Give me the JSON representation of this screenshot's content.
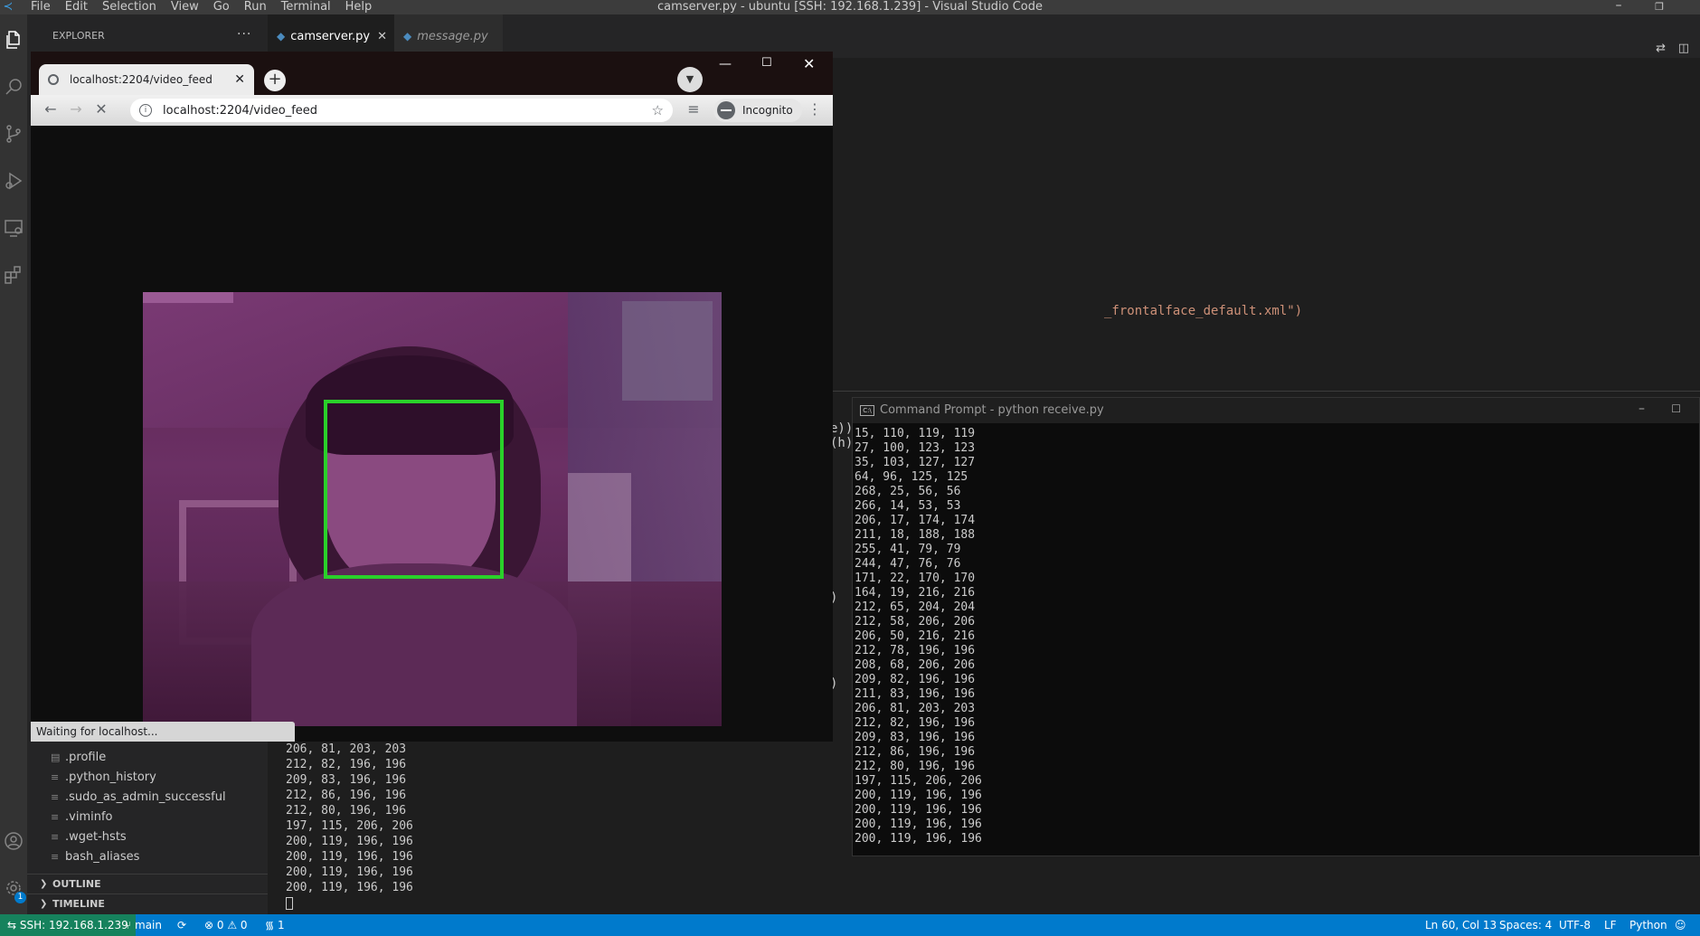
{
  "window": {
    "title": "camserver.py - ubuntu [SSH: 192.168.1.239] - Visual Studio Code",
    "menu": [
      "File",
      "Edit",
      "Selection",
      "View",
      "Go",
      "Run",
      "Terminal",
      "Help"
    ]
  },
  "sidebar": {
    "title": "EXPLORER",
    "more": "···",
    "files": [
      ".profile",
      ".python_history",
      ".sudo_as_admin_successful",
      ".viminfo",
      ".wget-hsts",
      "bash_aliases"
    ],
    "outline_label": "OUTLINE",
    "timeline_label": "TIMELINE"
  },
  "tabs": [
    {
      "label": "camserver.py",
      "active": true
    },
    {
      "label": "message.py",
      "active": false
    }
  ],
  "editor": {
    "visible_fragment": "_frontalface_default.xml\")"
  },
  "panel": {
    "edge_fragments": [
      "e)),",
      "(h)",
      ")",
      ")"
    ],
    "terminal_lines": [
      "206, 81, 203, 203",
      "212, 82, 196, 196",
      "209, 83, 196, 196",
      "212, 86, 196, 196",
      "212, 80, 196, 196",
      "197, 115, 206, 206",
      "200, 119, 196, 196",
      "200, 119, 196, 196",
      "200, 119, 196, 196",
      "200, 119, 196, 196"
    ]
  },
  "cmd": {
    "title": "Command Prompt - python  receive.py",
    "icon_text": "C:\\",
    "lines": [
      "15, 110, 119, 119",
      "27, 100, 123, 123",
      "35, 103, 127, 127",
      "64, 96, 125, 125",
      "268, 25, 56, 56",
      "266, 14, 53, 53",
      "206, 17, 174, 174",
      "211, 18, 188, 188",
      "255, 41, 79, 79",
      "244, 47, 76, 76",
      "171, 22, 170, 170",
      "164, 19, 216, 216",
      "212, 65, 204, 204",
      "212, 58, 206, 206",
      "206, 50, 216, 216",
      "212, 78, 196, 196",
      "208, 68, 206, 206",
      "209, 82, 196, 196",
      "211, 83, 196, 196",
      "206, 81, 203, 203",
      "212, 82, 196, 196",
      "209, 83, 196, 196",
      "212, 86, 196, 196",
      "212, 80, 196, 196",
      "197, 115, 206, 206",
      "200, 119, 196, 196",
      "200, 119, 196, 196",
      "200, 119, 196, 196",
      "200, 119, 196, 196"
    ]
  },
  "chrome": {
    "tab_title": "localhost:2204/video_feed",
    "url": "localhost:2204/video_feed",
    "incognito_label": "Incognito",
    "status": "Waiting for localhost...",
    "face_box_color": "#2ad02a"
  },
  "statusbar": {
    "remote": "SSH: 192.168.1.239",
    "branch": "main",
    "errors": "0",
    "warnings": "0",
    "ports": "1",
    "position": "Ln 60, Col 13",
    "spaces": "Spaces: 4",
    "encoding": "UTF-8",
    "eol": "LF",
    "language": "Python",
    "settings_badge": "1"
  },
  "colors": {
    "statusbar": "#007acc",
    "remote": "#16825d",
    "editor_bg": "#1e1e1e"
  }
}
